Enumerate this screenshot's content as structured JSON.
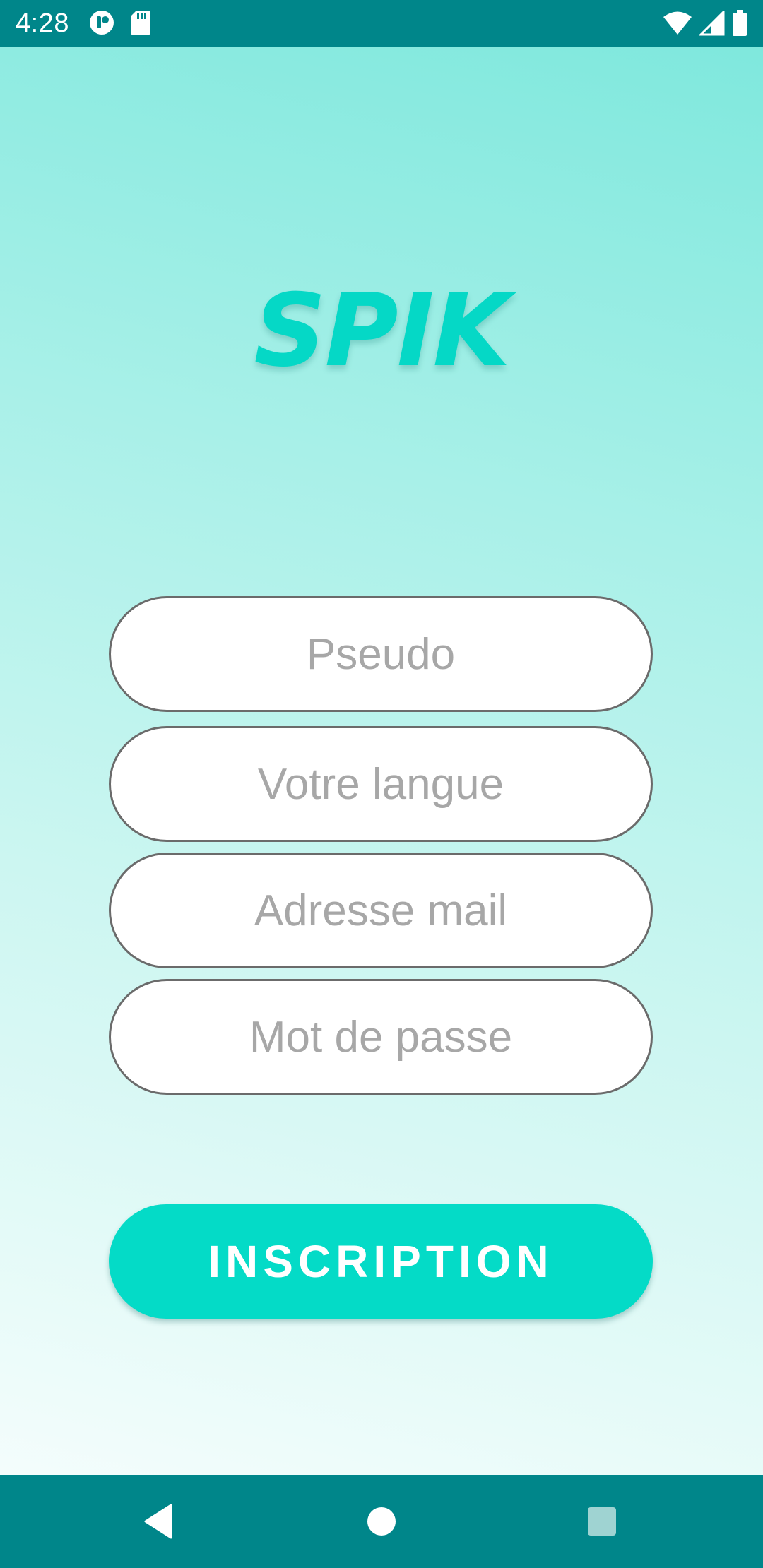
{
  "status_bar": {
    "time": "4:28",
    "background": "#00868a",
    "left_icons": [
      "notification-app-icon",
      "sd-card-icon"
    ],
    "right_icons": [
      "wifi-icon",
      "cell-signal-icon",
      "battery-icon"
    ]
  },
  "app": {
    "logo_text": "SPIK",
    "logo_color": "#05d8c6"
  },
  "form": {
    "pseudo_placeholder": "Pseudo",
    "language_placeholder": "Votre langue",
    "email_placeholder": "Adresse mail",
    "password_placeholder": "Mot de passe",
    "submit_label": "INSCRIPTION",
    "submit_color": "#04dbc7"
  },
  "nav_bar": {
    "background": "#00868a",
    "buttons": [
      "back-icon",
      "home-icon",
      "recents-icon"
    ]
  }
}
